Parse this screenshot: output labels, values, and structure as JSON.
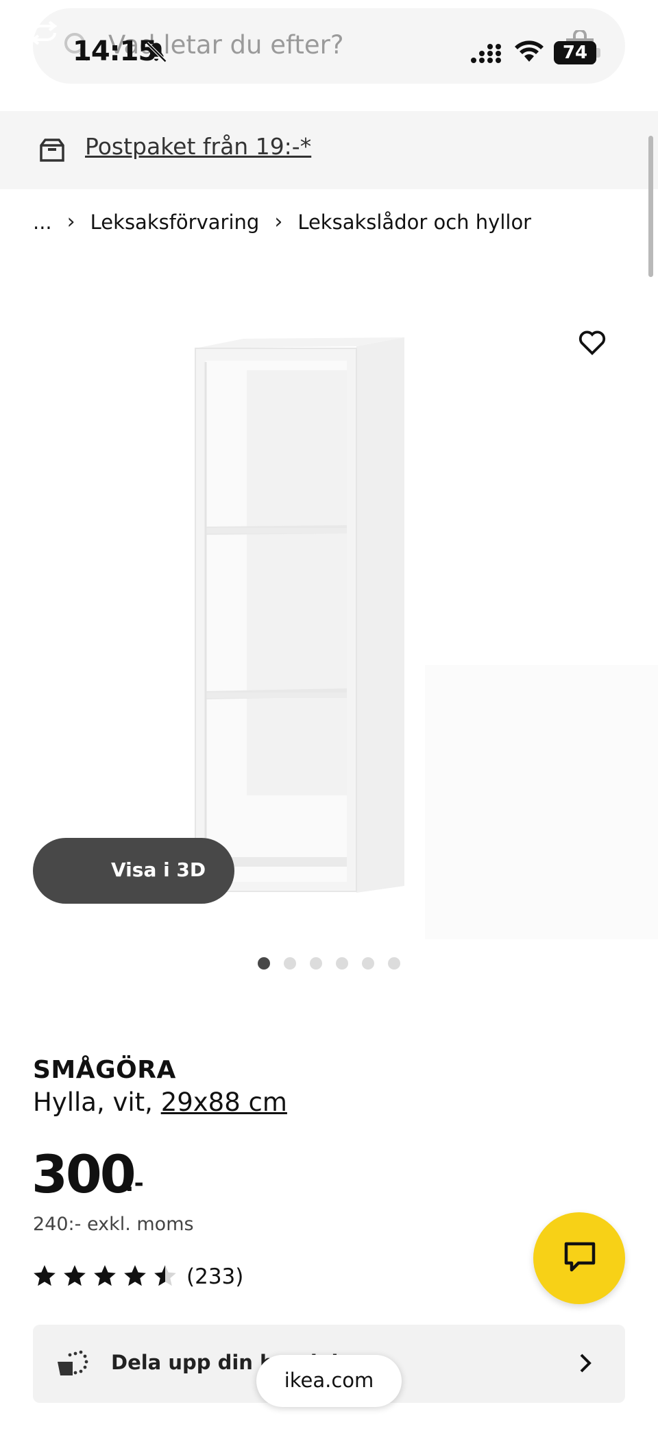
{
  "status_bar": {
    "time": "14:15",
    "battery": "74"
  },
  "search": {
    "placeholder": "Vad letar du efter?"
  },
  "promo": {
    "text": "Postpaket från 19:-*"
  },
  "breadcrumb": {
    "items": [
      "...",
      "Leksaksförvaring",
      "Leksakslådor och hyllor"
    ]
  },
  "gallery": {
    "view_3d_label": "Visa i 3D",
    "dot_count": 6,
    "active_index": 0
  },
  "product": {
    "name": "SMÅGÖRA",
    "desc_prefix": "Hylla, vit, ",
    "size": "29x88 cm",
    "price": "300",
    "price_suffix": ":-",
    "price_ex_vat": "240:- exkl. moms",
    "rating": 4.5,
    "rating_count": "(233)"
  },
  "payment": {
    "label": "Dela upp din betalning"
  },
  "browser": {
    "url": "ikea.com"
  },
  "colors": {
    "chat_accent": "#f7d117",
    "dark_button": "#484848"
  },
  "icons": [
    "search-icon",
    "bell-off-icon",
    "signal-icon",
    "wifi-icon",
    "battery-icon",
    "cart-icon",
    "box-icon",
    "heart-icon",
    "rotate-3d-icon",
    "star-icon",
    "chat-icon",
    "installment-icon",
    "chevron-right-icon"
  ]
}
